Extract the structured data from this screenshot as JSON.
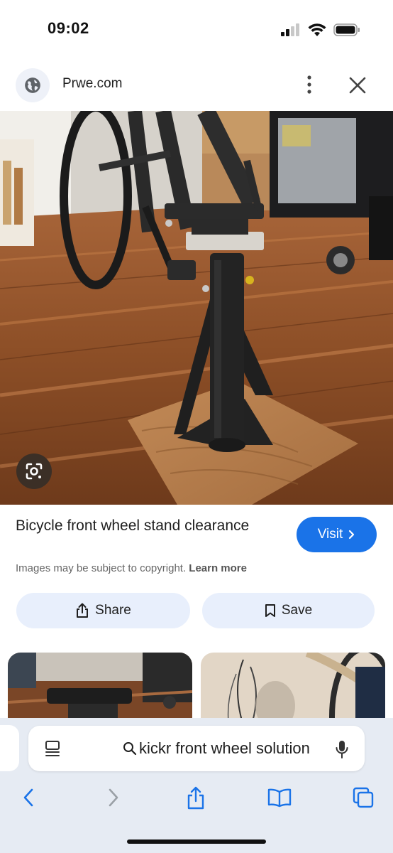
{
  "status_bar": {
    "time": "09:02",
    "icons": [
      "cellular-signal-icon",
      "wifi-icon",
      "battery-icon"
    ]
  },
  "site_bar": {
    "site_name": "Prwe.com",
    "icons": [
      "globe-icon",
      "more-vert-icon",
      "close-icon"
    ]
  },
  "result": {
    "title": "Bicycle front wheel stand clearance",
    "visit_label": "Visit",
    "copyright_text": "Images may be subject to copyright.",
    "learn_more": "Learn more",
    "share_label": "Share",
    "save_label": "Save"
  },
  "search": {
    "query": "kickr front wheel solution"
  },
  "toolbar": {
    "icons": [
      "back-icon",
      "forward-icon",
      "share-icon",
      "bookmarks-icon",
      "tabs-icon"
    ]
  },
  "colors": {
    "accent": "#1a73e8",
    "pill_background": "#e8effc",
    "bottom_sheet": "#e6ebf3",
    "toolbar_icon": "#1a73e8",
    "toolbar_icon_disabled": "#9aa0a6"
  }
}
